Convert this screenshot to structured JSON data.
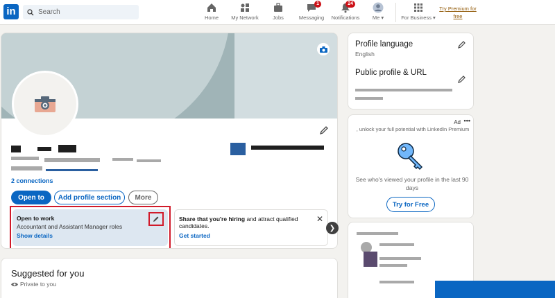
{
  "nav": {
    "search_placeholder": "Search",
    "items": [
      {
        "label": "Home",
        "icon": "home-icon"
      },
      {
        "label": "My Network",
        "icon": "network-icon"
      },
      {
        "label": "Jobs",
        "icon": "briefcase-icon"
      },
      {
        "label": "Messaging",
        "icon": "message-icon",
        "badge": "1"
      },
      {
        "label": "Notifications",
        "icon": "bell-icon",
        "badge": "24"
      },
      {
        "label": "Me ▾",
        "icon": "avatar-icon"
      },
      {
        "label": "For Business ▾",
        "icon": "grid-icon"
      }
    ],
    "premium": "Try Premium for free"
  },
  "profile": {
    "connections": "2 connections",
    "buttons": {
      "open_to": "Open to",
      "add_section": "Add profile section",
      "more": "More"
    },
    "open_to_work": {
      "title": "Open to work",
      "roles": "Accountant and Assistant Manager roles",
      "link": "Show details"
    },
    "hiring": {
      "bold": "Share that you're hiring",
      "rest": " and attract qualified candidates.",
      "link": "Get started"
    }
  },
  "suggested": {
    "title": "Suggested for you",
    "subtitle": "Private to you"
  },
  "sidebar": {
    "language": {
      "title": "Profile language",
      "value": "English"
    },
    "public_profile": {
      "title": "Public profile & URL"
    }
  },
  "ad": {
    "label": "Ad",
    "top_text": ", unlock your full potential with LinkedIn Premium",
    "text": "See who's viewed your profile in the last 90 days",
    "button": "Try for Free"
  },
  "colors": {
    "brand": "#0a66c2",
    "highlight": "#d11a2a",
    "badge": "#cc1016"
  }
}
